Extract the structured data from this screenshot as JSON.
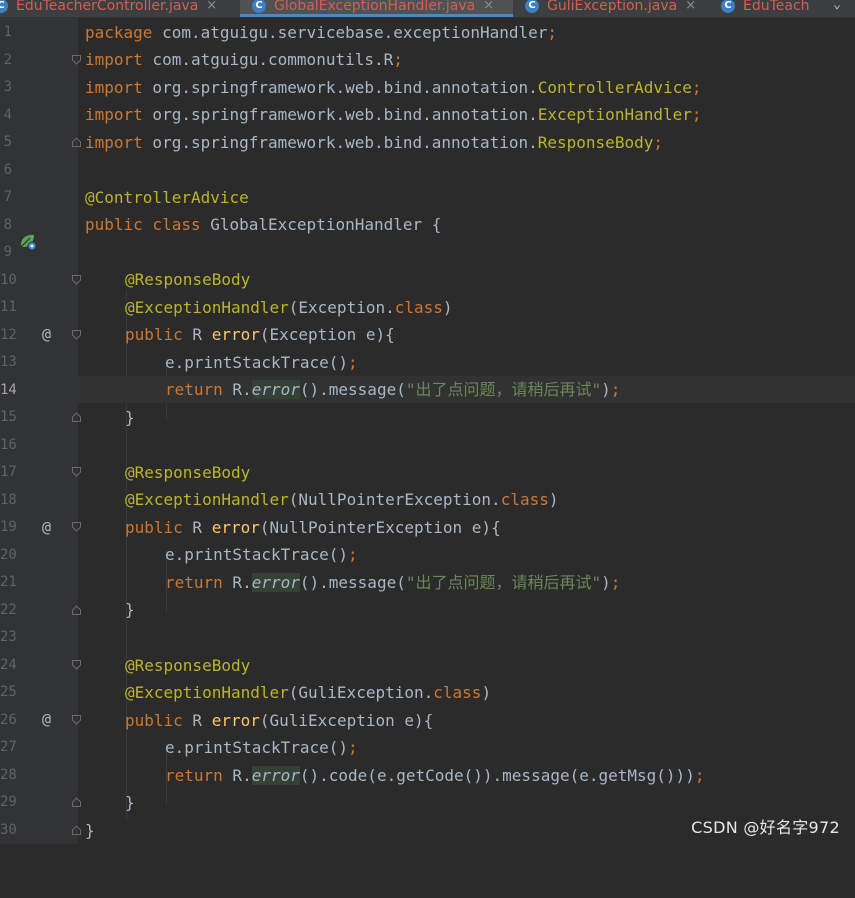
{
  "tabs": [
    {
      "label": "EduTeacherController.java",
      "active": false
    },
    {
      "label": "GlobalExceptionHandler.java",
      "active": true
    },
    {
      "label": "GuliException.java",
      "active": false
    },
    {
      "label": "EduTeach",
      "active": false
    }
  ],
  "tab_icon_letter": "C",
  "close_glyph": "×",
  "more_tabs_glyph": "⌄",
  "gutter": {
    "line_numbers": [
      "1",
      "2",
      "3",
      "4",
      "5",
      "6",
      "7",
      "8",
      "9",
      "10",
      "11",
      "12",
      "13",
      "14",
      "15",
      "16",
      "17",
      "18",
      "19",
      "20",
      "21",
      "22",
      "23",
      "24",
      "25",
      "26",
      "27",
      "28",
      "29",
      "30"
    ],
    "current_line": "14",
    "override_marker": "@"
  },
  "code": {
    "l1": {
      "kw": "package",
      "rest": " com.atguigu.servicebase.exceptionHandler",
      "semi": ";"
    },
    "l2": {
      "kw": "import",
      "rest": " com.atguigu.commonutils.R",
      "semi": ";"
    },
    "l3": {
      "kw": "import",
      "rest": " org.springframework.web.bind.annotation.",
      "cls": "ControllerAdvice",
      "semi": ";"
    },
    "l4": {
      "kw": "import",
      "rest": " org.springframework.web.bind.annotation.",
      "cls": "ExceptionHandler",
      "semi": ";"
    },
    "l5": {
      "kw": "import",
      "rest": " org.springframework.web.bind.annotation.",
      "cls": "ResponseBody",
      "semi": ";"
    },
    "l7": {
      "ann": "@ControllerAdvice"
    },
    "l8": {
      "kw": "public class",
      "rest": " GlobalExceptionHandler {"
    },
    "ann_response_body": "@ResponseBody",
    "ann_exception_handler": "@ExceptionHandler",
    "kw_class": "class",
    "kw_public": "public",
    "kw_return": "return",
    "type_r": " R ",
    "method_error": "error",
    "print_stack": "e.printStackTrace()",
    "semi": ";",
    "r_dot": " R.",
    "call_paren": "()",
    "message_open": ".message(",
    "message_text": "\"出了点问题，请稍后再试\"",
    "close_paren": ")",
    "close_brace": "}",
    "h1": {
      "paren_open": "(Exception.",
      "paren_close": ")",
      "sig": "(Exception e){"
    },
    "h2": {
      "paren_open": "(NullPointerException.",
      "paren_close": ")",
      "sig": "(NullPointerException e){"
    },
    "h3": {
      "paren_open": "(GuliException.",
      "paren_close": ")",
      "sig": "(GuliException e){",
      "ret_tail": ".code(e.getCode()).message(e.getMsg())"
    }
  },
  "watermark": "CSDN @好名字972",
  "colors": {
    "background": "#2b2b2b",
    "keyword": "#cc7832",
    "annotation": "#bbb529",
    "string": "#6a8759",
    "method_decl": "#ffc66d",
    "plain": "#a9b7c6",
    "tab_text": "#d65d4f",
    "tab_underline": "#4a88c7"
  }
}
